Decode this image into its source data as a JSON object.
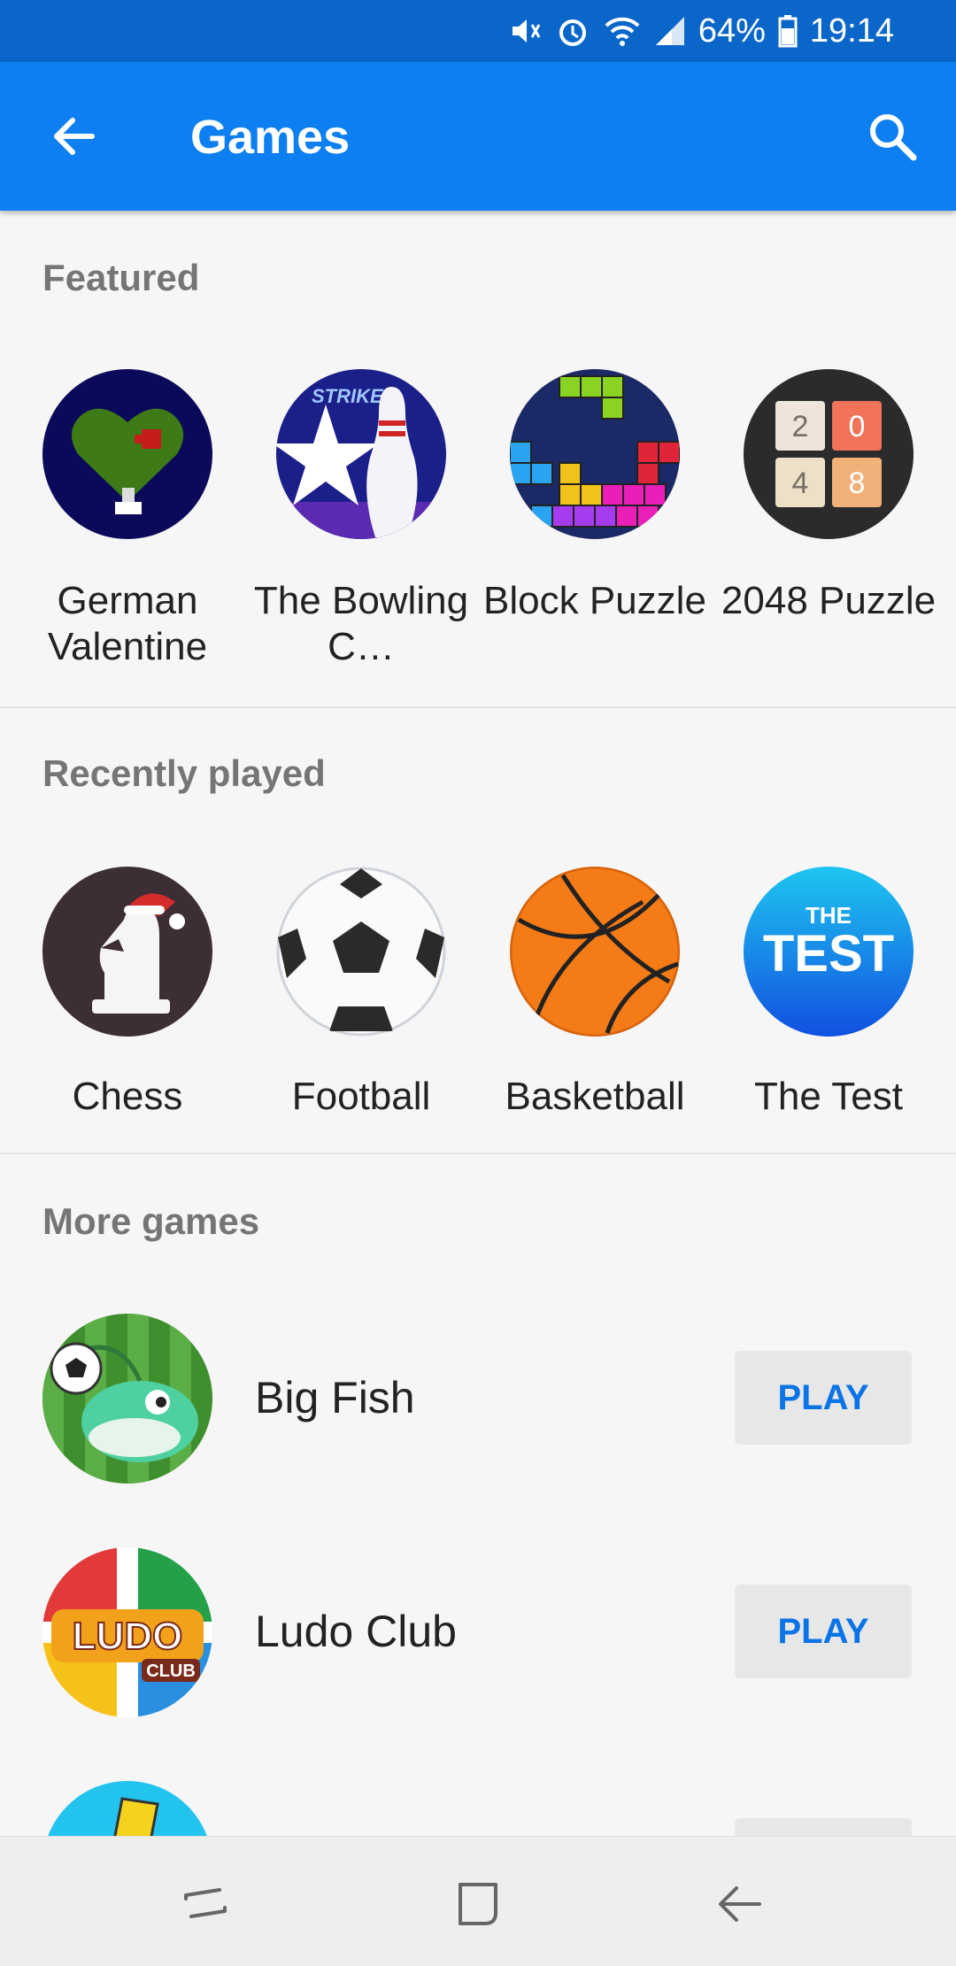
{
  "status_bar": {
    "battery": "64%",
    "time": "19:14",
    "icons": [
      "mute-icon",
      "alarm-icon",
      "wifi-icon",
      "signal-icon",
      "battery-icon"
    ]
  },
  "app_bar": {
    "title": "Games",
    "icons": [
      "back-arrow-icon",
      "search-icon"
    ]
  },
  "featured": {
    "title": "Featured",
    "items": [
      {
        "label": "German Valentine"
      },
      {
        "label": "The Bowling C…"
      },
      {
        "label": "Block Puzzle"
      },
      {
        "label": "2048 Puzzle"
      }
    ]
  },
  "recent": {
    "title": "Recently played",
    "items": [
      {
        "label": "Chess"
      },
      {
        "label": "Football"
      },
      {
        "label": "Basketball"
      },
      {
        "label": "The Test"
      }
    ]
  },
  "more": {
    "title": "More games",
    "play_label": "PLAY",
    "items": [
      {
        "name": "Big Fish"
      },
      {
        "name": "Ludo Club"
      },
      {
        "name": ""
      }
    ]
  },
  "icon_text": {
    "puzzle_2048": [
      "2",
      "0",
      "4",
      "8"
    ],
    "test_top": "THE",
    "test_main": "TEST",
    "ludo_main": "LUDO",
    "ludo_sub": "CLUB",
    "bowling_text": "STRIKE"
  },
  "colors": {
    "status_bar": "#0a67c9",
    "app_bar": "#0d7ff0",
    "play_text": "#0a74e6",
    "play_bg": "#e7e7e7"
  }
}
